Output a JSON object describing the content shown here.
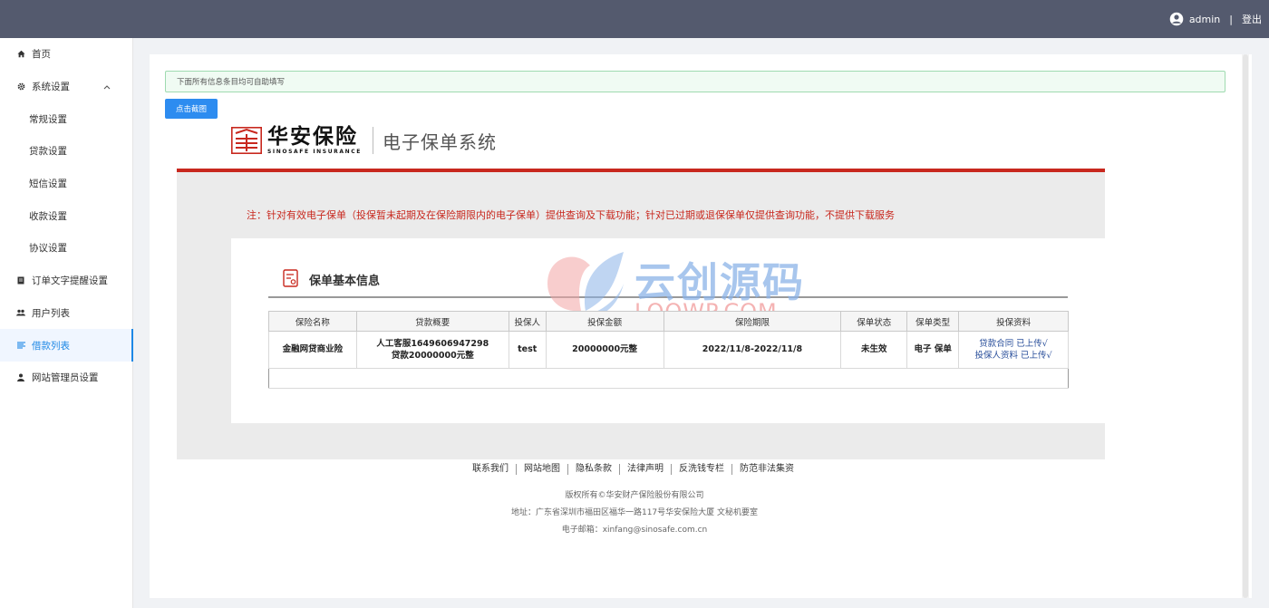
{
  "topbar": {
    "username": "admin",
    "separator": "|",
    "logout": "登出"
  },
  "sidebar": {
    "items": [
      {
        "label": "首页",
        "icon": "home-icon"
      },
      {
        "label": "系统设置",
        "icon": "gear-icon"
      },
      {
        "label": "常规设置"
      },
      {
        "label": "贷款设置"
      },
      {
        "label": "短信设置"
      },
      {
        "label": "收款设置"
      },
      {
        "label": "协议设置"
      },
      {
        "label": "订单文字提醒设置",
        "icon": "document-icon"
      },
      {
        "label": "用户列表",
        "icon": "users-icon"
      },
      {
        "label": "借款列表",
        "icon": "list-icon",
        "active": true
      },
      {
        "label": "网站管理员设置",
        "icon": "user-icon"
      }
    ]
  },
  "main": {
    "notice": "下面所有信息条目均可自助填写",
    "screenshot_button": "点击截图",
    "logo": {
      "cn": "华安保险",
      "en": "SINOSAFE INSURANCE",
      "system": "电子保单系统"
    },
    "red_note": "注：针对有效电子保单（投保暂未起期及在保险期限内的电子保单）提供查询及下载功能；针对已过期或退保保单仅提供查询功能，不提供下载服务",
    "section_title": "保单基本信息",
    "watermark": {
      "cn": "云创源码",
      "en": "LOOWP.COM"
    },
    "table": {
      "headers": [
        "保险名称",
        "贷款概要",
        "投保人",
        "投保金额",
        "保险期限",
        "保单状态",
        "保单类型",
        "投保资料"
      ],
      "row": {
        "name": "金融网贷商业险",
        "summary_line1": "人工客服1649606947298",
        "summary_line2": "贷款20000000元整",
        "insured": "test",
        "amount": "20000000元整",
        "period": "2022/11/8-2022/11/8",
        "status": "未生效",
        "type": "电子 保单",
        "doc1": "贷款合同 已上传√",
        "doc2": "投保人资料 已上传√"
      }
    }
  },
  "footer": {
    "links": [
      "联系我们",
      "网站地图",
      "隐私条款",
      "法律声明",
      "反洗钱专栏",
      "防范非法集资"
    ],
    "copyright": "版权所有©华安财产保险股份有限公司",
    "address": "地址：广东省深圳市福田区福华一路117号华安保险大厦 文秘机要室",
    "email": "电子邮箱：xinfang@sinosafe.com.cn"
  },
  "colors": {
    "topbar": "#545a6e",
    "accent": "#2d8cf0",
    "brand_red": "#c8281e"
  }
}
